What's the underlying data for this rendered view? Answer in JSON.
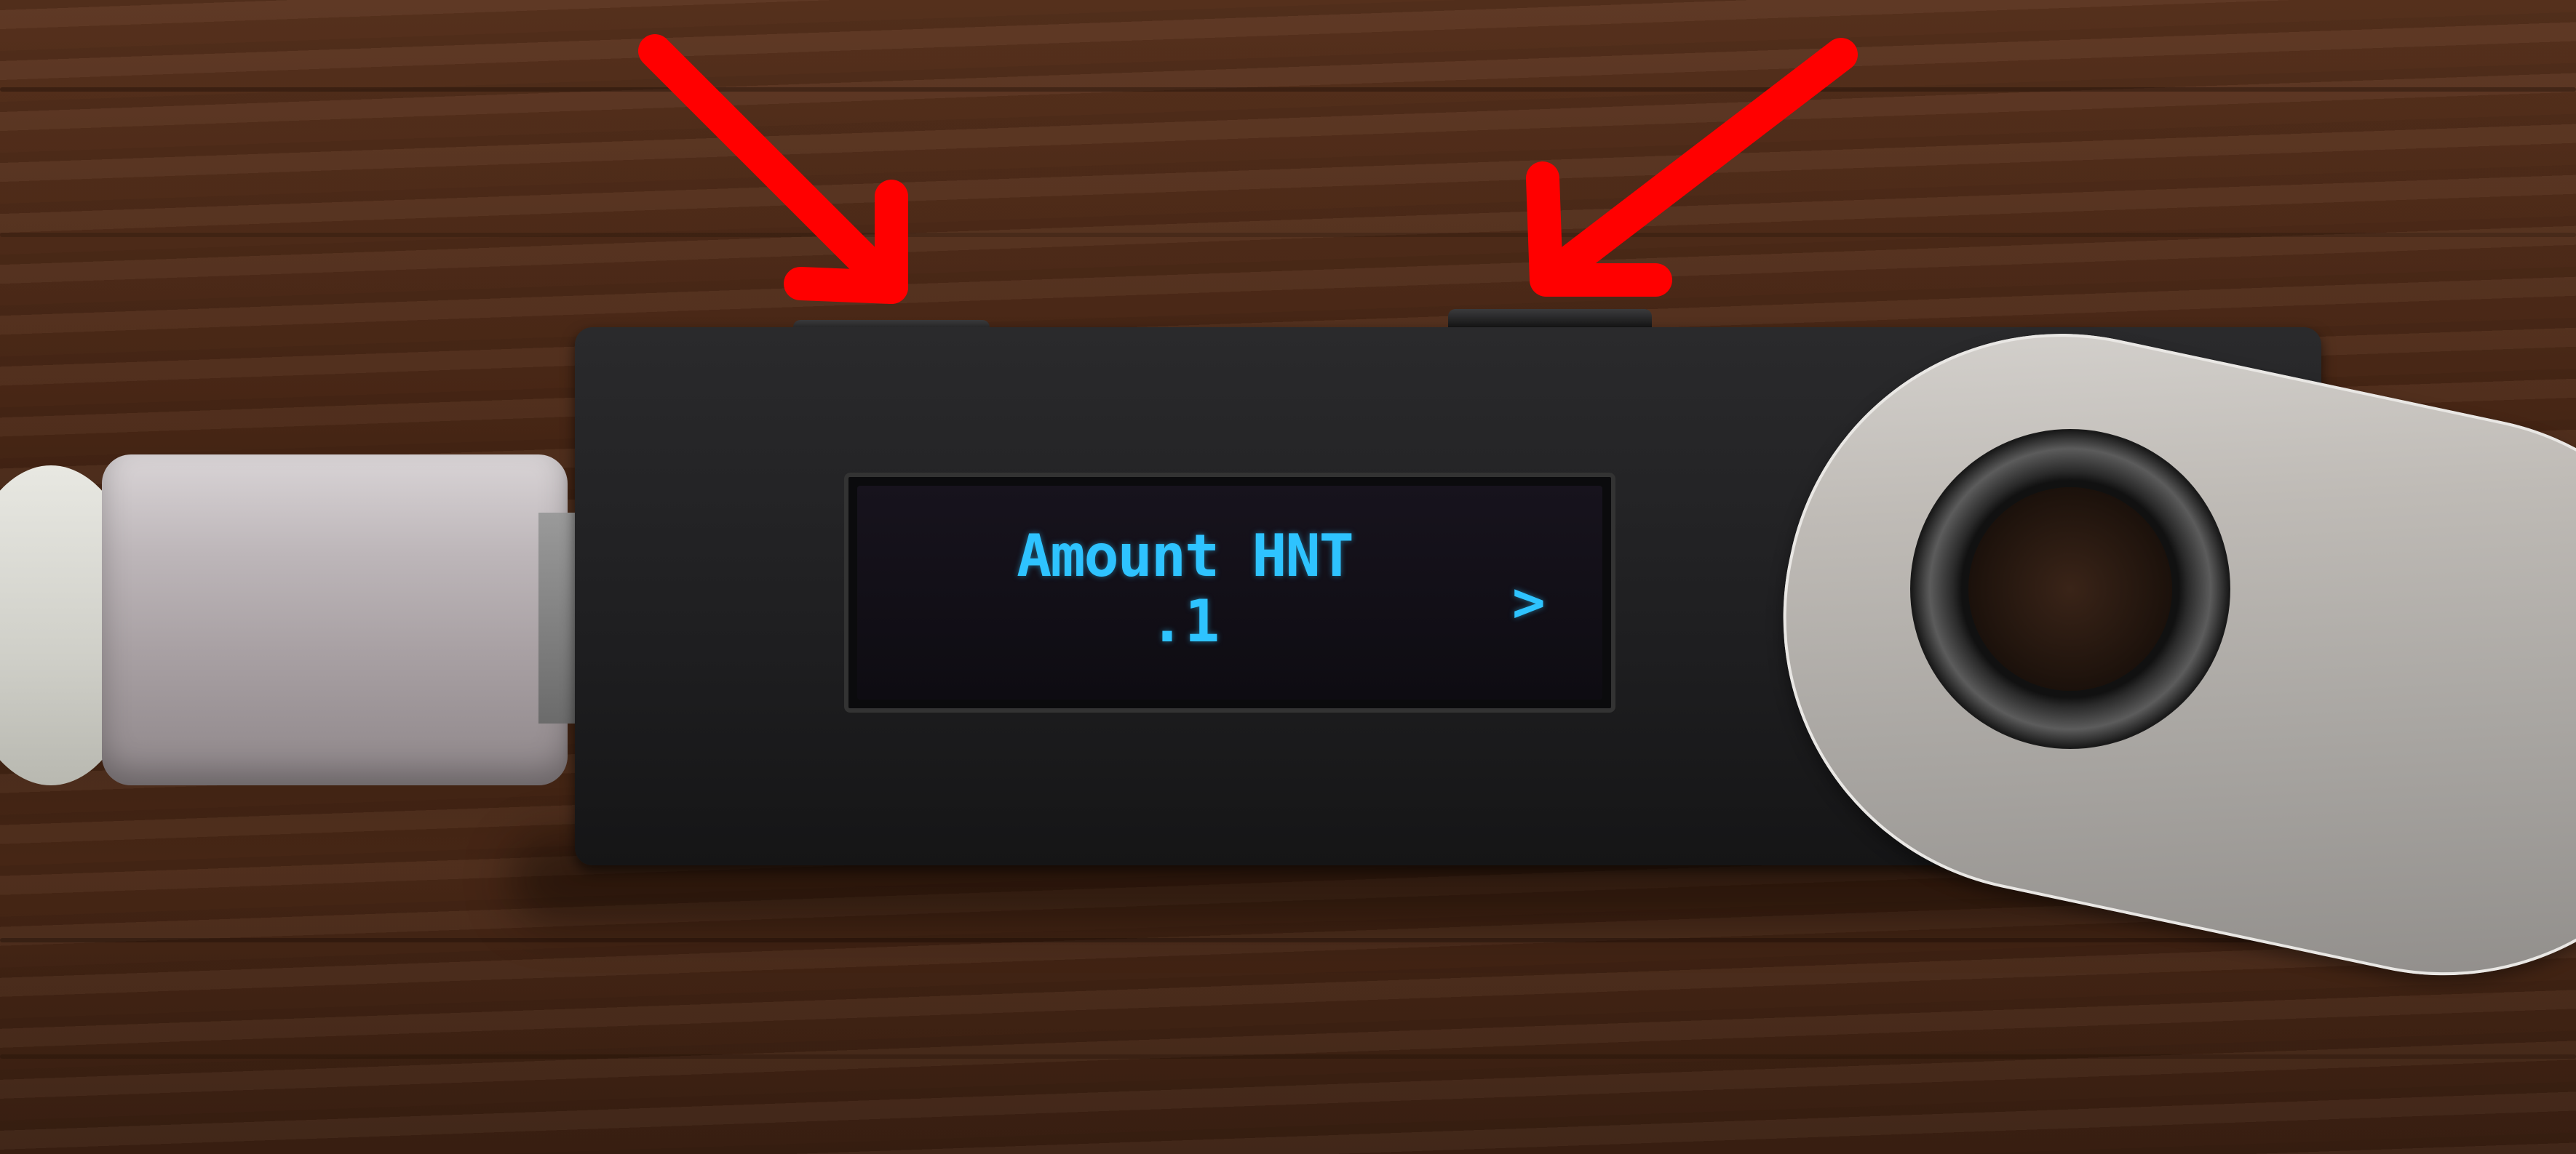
{
  "device_screen": {
    "title": "Amount HNT",
    "value": ".1",
    "next_indicator": ">"
  },
  "annotations": {
    "arrow_color": "#ff0000",
    "arrows": [
      "arrow-pointing-left-button",
      "arrow-pointing-right-button"
    ]
  },
  "colors": {
    "screen_text": "#2ec3ff",
    "device_body": "#1e1e20",
    "table_wood": "#4b2816"
  }
}
